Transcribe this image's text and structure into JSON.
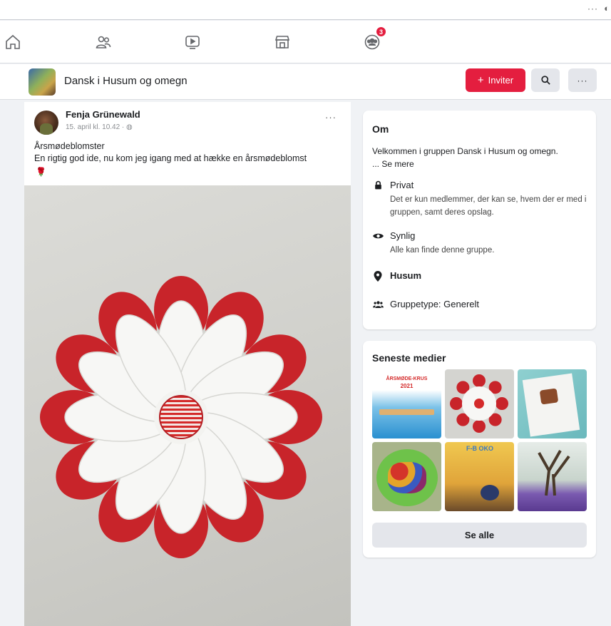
{
  "window": {
    "more_label": "···",
    "shield_label": "◐"
  },
  "nav": {
    "notification_count": "3"
  },
  "group": {
    "name": "Dansk i Husum og omegn",
    "invite_label": "Inviter",
    "more_label": "···"
  },
  "post": {
    "author": "Fenja Grünewald",
    "time": "15. april kl. 10.42 · ◍",
    "more_label": "···",
    "title": "Årsmødeblomster",
    "body": "En rigtig god ide, nu kom jeg igang med at hække en årsmødeblomst",
    "emoji": "🌹"
  },
  "about": {
    "heading": "Om",
    "description": "Velkommen i gruppen Dansk i Husum og omegn.",
    "see_more": "... Se mere",
    "privacy_title": "Privat",
    "privacy_desc": "Det er kun medlemmer, der kan se, hvem der er med i gruppen, samt deres opslag.",
    "visibility_title": "Synlig",
    "visibility_desc": "Alle kan finde denne gruppe.",
    "location": "Husum",
    "group_type": "Gruppetype: Generelt"
  },
  "media": {
    "heading": "Seneste medier",
    "thumb1_caption": "ÅRSMØDE-KRUS",
    "thumb1_year": "2021",
    "thumb5_caption": "F-B OKO",
    "see_all_label": "Se alle"
  },
  "colors": {
    "accent": "#e41e3f",
    "badge": "#e41e3f",
    "background": "#f0f2f5"
  }
}
